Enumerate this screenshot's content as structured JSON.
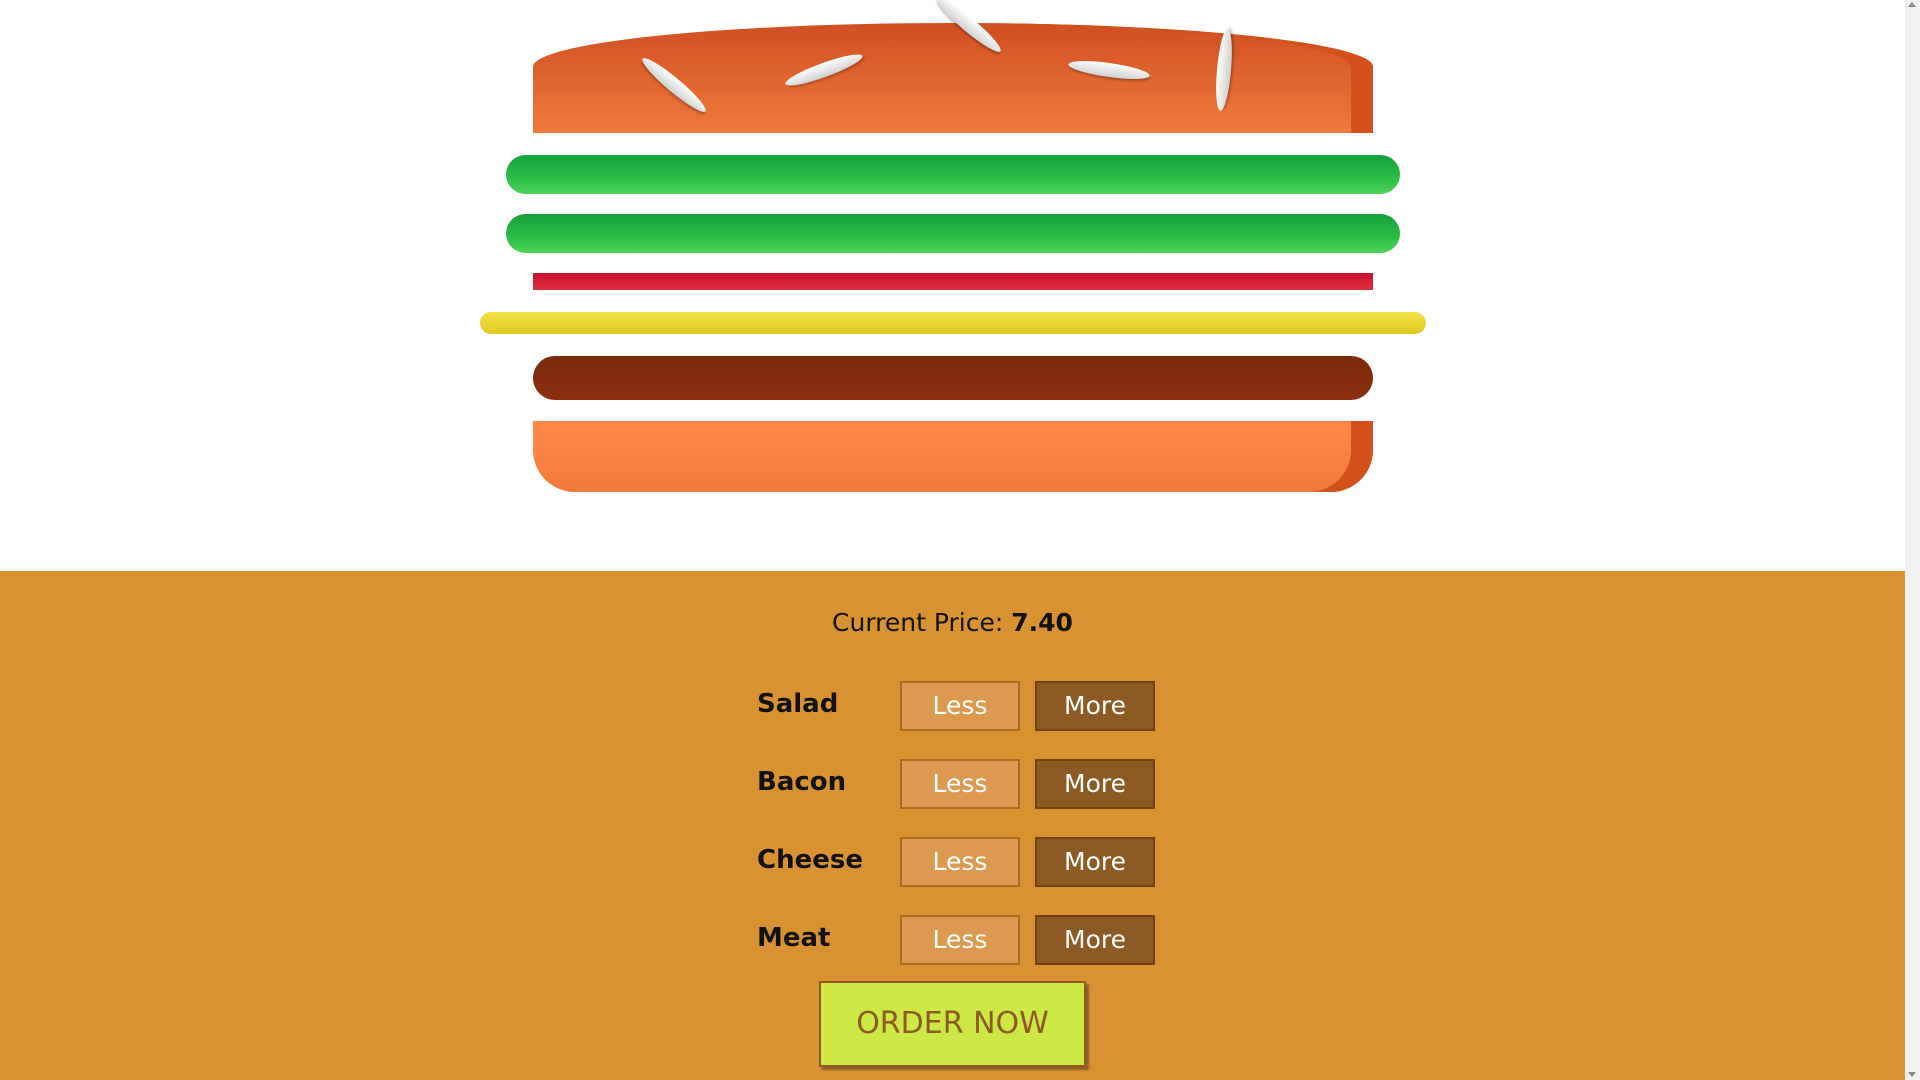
{
  "price": {
    "label": "Current Price: ",
    "value": "7.40"
  },
  "ingredients": [
    {
      "name": "Salad",
      "less": "Less",
      "more": "More"
    },
    {
      "name": "Bacon",
      "less": "Less",
      "more": "More"
    },
    {
      "name": "Cheese",
      "less": "Less",
      "more": "More"
    },
    {
      "name": "Meat",
      "less": "Less",
      "more": "More"
    }
  ],
  "order_button": "ORDER NOW",
  "burger": {
    "layers": [
      "bread-top",
      "salad",
      "salad",
      "bacon",
      "cheese",
      "meat",
      "bread-bottom"
    ],
    "salad_count": 2,
    "bacon_count": 1,
    "cheese_count": 1,
    "meat_count": 1
  },
  "colors": {
    "control_background": "#d89232",
    "less_button": "#db9a50",
    "more_button": "#8e5a24",
    "order_button": "#cde844",
    "bread": "#f07a3c",
    "salad": "#2bbd45",
    "bacon": "#c8102e",
    "cheese": "#e0c820",
    "meat": "#7b2a0c"
  }
}
